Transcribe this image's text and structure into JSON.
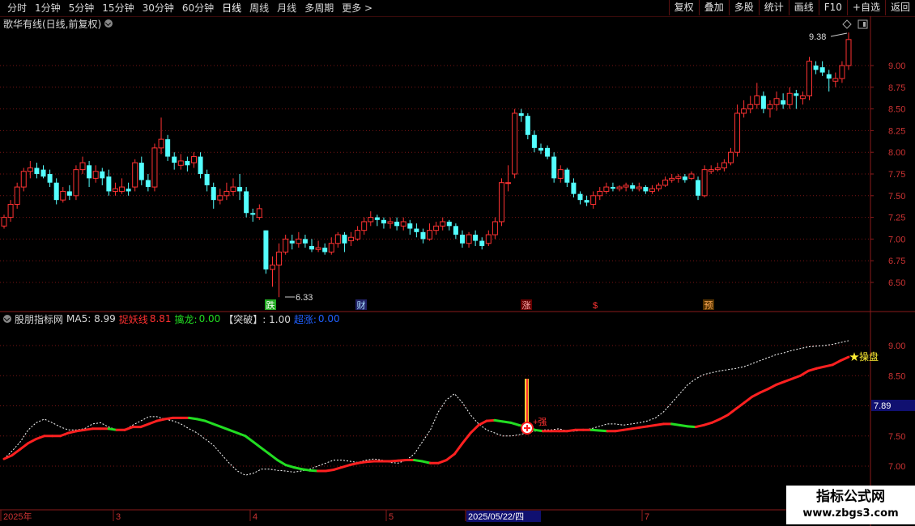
{
  "toolbar": {
    "periods": [
      "分时",
      "1分钟",
      "5分钟",
      "15分钟",
      "30分钟",
      "60分钟",
      "日线",
      "周线",
      "月线",
      "多周期",
      "更多 >"
    ],
    "active_period": "日线",
    "right_buttons": [
      "复权",
      "叠加",
      "多股",
      "统计",
      "画线",
      "F10",
      "+自选",
      "返回"
    ]
  },
  "main_chart": {
    "title": "歌华有线(日线,前复权)",
    "high_label": "9.38",
    "low_label": "6.33",
    "price_ticks": [
      "9.00",
      "8.75",
      "8.50",
      "8.25",
      "8.00",
      "7.75",
      "7.50",
      "7.25",
      "7.00",
      "6.75",
      "6.50"
    ],
    "markers": [
      "跌",
      "财",
      "涨",
      "$",
      "预"
    ]
  },
  "indicator": {
    "name": "股朋指标网",
    "ma5_label": "MA5: 8.99",
    "yaoxian_label": "捉妖线",
    "yaoxian_value": "8.81",
    "qinlong_label": "擒龙:",
    "qinlong_value": "0.00",
    "tupo_label": "【突破】: 1.00",
    "chaozhang_label": "超涨:",
    "chaozhang_value": "0.00",
    "ticks": [
      "9.00",
      "8.50",
      "8.00",
      "7.50",
      "7.00"
    ],
    "current_value_badge": "7.89",
    "star_label": "★操盘",
    "signal_label": "+强"
  },
  "date_axis": {
    "labels": [
      "2025年",
      "3",
      "4",
      "5",
      "2025/05/22/四",
      "7"
    ]
  },
  "watermark": {
    "line1": "指标公式网",
    "line2": "www.zbgs3.com"
  },
  "colors": {
    "up": "#ff3232",
    "down": "#54ffff",
    "grid": "#7a1515",
    "ma_red": "#ff2020",
    "ma_green": "#22dd22"
  },
  "chart_data": {
    "type": "candlestick",
    "ylim": [
      6.3,
      9.5
    ],
    "candles": [
      [
        7.15,
        7.25,
        7.28,
        7.12
      ],
      [
        7.25,
        7.4,
        7.45,
        7.2
      ],
      [
        7.4,
        7.6,
        7.65,
        7.35
      ],
      [
        7.6,
        7.78,
        7.82,
        7.55
      ],
      [
        7.78,
        7.82,
        7.9,
        7.7
      ],
      [
        7.82,
        7.75,
        7.88,
        7.7
      ],
      [
        7.8,
        7.72,
        7.85,
        7.7
      ],
      [
        7.75,
        7.65,
        7.8,
        7.6
      ],
      [
        7.65,
        7.45,
        7.7,
        7.4
      ],
      [
        7.45,
        7.55,
        7.6,
        7.42
      ],
      [
        7.55,
        7.5,
        7.62,
        7.45
      ],
      [
        7.5,
        7.8,
        7.85,
        7.45
      ],
      [
        7.8,
        7.88,
        7.95,
        7.75
      ],
      [
        7.85,
        7.7,
        7.9,
        7.6
      ],
      [
        7.7,
        7.78,
        7.85,
        7.65
      ],
      [
        7.78,
        7.7,
        7.82,
        7.62
      ],
      [
        7.72,
        7.55,
        7.8,
        7.5
      ],
      [
        7.55,
        7.58,
        7.65,
        7.5
      ],
      [
        7.55,
        7.6,
        7.7,
        7.52
      ],
      [
        7.58,
        7.55,
        7.65,
        7.5
      ],
      [
        7.6,
        7.88,
        7.92,
        7.55
      ],
      [
        7.88,
        7.68,
        7.95,
        7.62
      ],
      [
        7.68,
        7.6,
        7.75,
        7.55
      ],
      [
        7.6,
        8.05,
        8.1,
        7.55
      ],
      [
        8.05,
        8.15,
        8.4,
        7.98
      ],
      [
        8.15,
        7.95,
        8.2,
        7.9
      ],
      [
        7.95,
        7.88,
        8.0,
        7.8
      ],
      [
        7.85,
        7.9,
        7.98,
        7.8
      ],
      [
        7.9,
        7.85,
        7.95,
        7.78
      ],
      [
        7.88,
        7.95,
        8.0,
        7.82
      ],
      [
        7.95,
        7.75,
        8.0,
        7.7
      ],
      [
        7.75,
        7.62,
        7.8,
        7.55
      ],
      [
        7.6,
        7.45,
        7.65,
        7.35
      ],
      [
        7.45,
        7.5,
        7.58,
        7.4
      ],
      [
        7.5,
        7.55,
        7.65,
        7.45
      ],
      [
        7.55,
        7.6,
        7.7,
        7.5
      ],
      [
        7.6,
        7.55,
        7.75,
        7.45
      ],
      [
        7.55,
        7.3,
        7.6,
        7.25
      ],
      [
        7.3,
        7.28,
        7.35,
        7.2
      ],
      [
        7.25,
        7.35,
        7.4,
        7.22
      ],
      [
        7.1,
        6.65,
        7.1,
        6.6
      ],
      [
        6.65,
        6.7,
        6.8,
        6.45
      ],
      [
        6.7,
        6.85,
        6.95,
        6.33
      ],
      [
        6.85,
        7.0,
        7.05,
        6.82
      ],
      [
        6.98,
        6.95,
        7.05,
        6.88
      ],
      [
        6.95,
        7.0,
        7.08,
        6.9
      ],
      [
        7.0,
        6.95,
        7.05,
        6.9
      ],
      [
        6.92,
        6.88,
        7.0,
        6.85
      ],
      [
        6.88,
        6.9,
        6.98,
        6.85
      ],
      [
        6.9,
        6.85,
        6.95,
        6.82
      ],
      [
        6.85,
        6.95,
        7.02,
        6.82
      ],
      [
        6.95,
        7.05,
        7.08,
        6.9
      ],
      [
        7.05,
        6.95,
        7.08,
        6.85
      ],
      [
        6.98,
        7.02,
        7.08,
        6.92
      ],
      [
        7.0,
        7.1,
        7.15,
        6.98
      ],
      [
        7.1,
        7.2,
        7.25,
        7.05
      ],
      [
        7.2,
        7.25,
        7.32,
        7.15
      ],
      [
        7.25,
        7.22,
        7.28,
        7.15
      ],
      [
        7.22,
        7.18,
        7.25,
        7.12
      ],
      [
        7.18,
        7.2,
        7.25,
        7.12
      ],
      [
        7.2,
        7.15,
        7.25,
        7.1
      ],
      [
        7.15,
        7.2,
        7.25,
        7.1
      ],
      [
        7.18,
        7.12,
        7.22,
        7.05
      ],
      [
        7.12,
        7.08,
        7.18,
        7.02
      ],
      [
        7.08,
        7.0,
        7.12,
        6.95
      ],
      [
        7.0,
        7.1,
        7.18,
        6.98
      ],
      [
        7.1,
        7.15,
        7.2,
        7.05
      ],
      [
        7.15,
        7.2,
        7.25,
        7.1
      ],
      [
        7.2,
        7.15,
        7.22,
        7.1
      ],
      [
        7.15,
        7.05,
        7.18,
        7.0
      ],
      [
        7.05,
        6.95,
        7.1,
        6.9
      ],
      [
        6.95,
        7.05,
        7.08,
        6.9
      ],
      [
        7.05,
        6.98,
        7.1,
        6.92
      ],
      [
        6.98,
        6.92,
        7.02,
        6.88
      ],
      [
        6.95,
        7.05,
        7.1,
        6.92
      ],
      [
        7.05,
        7.2,
        7.25,
        7.0
      ],
      [
        7.2,
        7.65,
        7.7,
        7.15
      ],
      [
        7.65,
        7.65,
        7.85,
        7.55
      ],
      [
        7.75,
        8.45,
        8.5,
        7.7
      ],
      [
        8.45,
        8.42,
        8.5,
        8.35
      ],
      [
        8.42,
        8.2,
        8.45,
        8.15
      ],
      [
        8.2,
        8.05,
        8.25,
        8.0
      ],
      [
        8.05,
        8.02,
        8.1,
        7.98
      ],
      [
        8.05,
        7.95,
        8.08,
        7.92
      ],
      [
        7.95,
        7.7,
        8.0,
        7.65
      ],
      [
        7.7,
        7.8,
        7.85,
        7.65
      ],
      [
        7.8,
        7.65,
        7.82,
        7.6
      ],
      [
        7.65,
        7.52,
        7.7,
        7.48
      ],
      [
        7.52,
        7.45,
        7.55,
        7.4
      ],
      [
        7.45,
        7.42,
        7.5,
        7.38
      ],
      [
        7.4,
        7.5,
        7.55,
        7.35
      ],
      [
        7.5,
        7.55,
        7.6,
        7.45
      ],
      [
        7.55,
        7.6,
        7.65,
        7.52
      ],
      [
        7.6,
        7.58,
        7.65,
        7.55
      ],
      [
        7.58,
        7.6,
        7.62,
        7.55
      ],
      [
        7.6,
        7.62,
        7.65,
        7.55
      ],
      [
        7.62,
        7.58,
        7.65,
        7.55
      ],
      [
        7.58,
        7.6,
        7.65,
        7.55
      ],
      [
        7.6,
        7.55,
        7.62,
        7.52
      ],
      [
        7.55,
        7.58,
        7.62,
        7.52
      ],
      [
        7.58,
        7.62,
        7.65,
        7.55
      ],
      [
        7.62,
        7.68,
        7.72,
        7.6
      ],
      [
        7.68,
        7.7,
        7.75,
        7.65
      ],
      [
        7.7,
        7.72,
        7.75,
        7.65
      ],
      [
        7.72,
        7.68,
        7.75,
        7.65
      ],
      [
        7.7,
        7.75,
        7.78,
        7.68
      ],
      [
        7.68,
        7.5,
        7.72,
        7.45
      ],
      [
        7.5,
        7.8,
        7.85,
        7.48
      ],
      [
        7.78,
        7.8,
        7.85,
        7.75
      ],
      [
        7.8,
        7.82,
        7.88,
        7.78
      ],
      [
        7.82,
        7.88,
        7.92,
        7.78
      ],
      [
        7.88,
        8.0,
        8.05,
        7.85
      ],
      [
        8.0,
        8.45,
        8.55,
        7.95
      ],
      [
        8.45,
        8.5,
        8.6,
        8.4
      ],
      [
        8.5,
        8.55,
        8.65,
        8.45
      ],
      [
        8.55,
        8.65,
        8.8,
        8.5
      ],
      [
        8.65,
        8.5,
        8.7,
        8.45
      ],
      [
        8.5,
        8.55,
        8.6,
        8.4
      ],
      [
        8.55,
        8.62,
        8.7,
        8.48
      ],
      [
        8.6,
        8.55,
        8.68,
        8.5
      ],
      [
        8.55,
        8.68,
        8.75,
        8.5
      ],
      [
        8.68,
        8.65,
        8.72,
        8.5
      ],
      [
        8.62,
        8.65,
        8.7,
        8.55
      ],
      [
        8.65,
        9.05,
        9.1,
        8.6
      ],
      [
        9.0,
        8.95,
        9.05,
        8.9
      ],
      [
        8.98,
        8.92,
        9.05,
        8.88
      ],
      [
        8.9,
        8.85,
        8.95,
        8.7
      ],
      [
        8.82,
        8.85,
        8.92,
        8.75
      ],
      [
        8.85,
        9.0,
        9.05,
        8.8
      ],
      [
        9.0,
        9.3,
        9.38,
        8.95
      ]
    ],
    "indicator_yaoxian": [
      7.12,
      7.18,
      7.28,
      7.38,
      7.45,
      7.5,
      7.5,
      7.5,
      7.55,
      7.58,
      7.6,
      7.62,
      7.62,
      7.62,
      7.6,
      7.6,
      7.65,
      7.65,
      7.7,
      7.75,
      7.78,
      7.8,
      7.8,
      7.8,
      7.78,
      7.75,
      7.7,
      7.65,
      7.6,
      7.55,
      7.5,
      7.4,
      7.3,
      7.2,
      7.1,
      7.02,
      6.98,
      6.95,
      6.93,
      6.92,
      6.92,
      6.94,
      6.98,
      7.02,
      7.05,
      7.07,
      7.08,
      7.08,
      7.08,
      7.09,
      7.1,
      7.1,
      7.08,
      7.05,
      7.05,
      7.1,
      7.2,
      7.38,
      7.55,
      7.68,
      7.75,
      7.76,
      7.74,
      7.72,
      7.68,
      7.65,
      7.6,
      7.58,
      7.58,
      7.58,
      7.58,
      7.6,
      7.6,
      7.6,
      7.59,
      7.58,
      7.58,
      7.6,
      7.62,
      7.64,
      7.66,
      7.68,
      7.7,
      7.7,
      7.68,
      7.66,
      7.65,
      7.68,
      7.72,
      7.78,
      7.85,
      7.95,
      8.05,
      8.15,
      8.22,
      8.28,
      8.35,
      8.4,
      8.45,
      8.5,
      8.58,
      8.62,
      8.65,
      8.68,
      8.75,
      8.81
    ],
    "indicator_ma": [
      7.12,
      7.25,
      7.4,
      7.6,
      7.72,
      7.78,
      7.72,
      7.65,
      7.6,
      7.6,
      7.62,
      7.7,
      7.72,
      7.65,
      7.6,
      7.6,
      7.68,
      7.75,
      7.82,
      7.82,
      7.78,
      7.75,
      7.7,
      7.62,
      7.55,
      7.45,
      7.35,
      7.2,
      7.05,
      6.92,
      6.85,
      6.88,
      6.95,
      6.95,
      6.93,
      6.92,
      6.9,
      6.92,
      6.95,
      7.0,
      7.05,
      7.1,
      7.1,
      7.08,
      7.06,
      7.1,
      7.12,
      7.1,
      7.06,
      7.05,
      7.1,
      7.2,
      7.4,
      7.6,
      7.9,
      8.1,
      8.2,
      8.05,
      7.85,
      7.7,
      7.6,
      7.55,
      7.5,
      7.5,
      7.52,
      7.55,
      7.58,
      7.6,
      7.6,
      7.62,
      7.58,
      7.58,
      7.6,
      7.62,
      7.66,
      7.7,
      7.7,
      7.68,
      7.7,
      7.72,
      7.75,
      7.8,
      7.9,
      8.05,
      8.2,
      8.35,
      8.45,
      8.52,
      8.55,
      8.58,
      8.6,
      8.62,
      8.65,
      8.7,
      8.75,
      8.8,
      8.85,
      8.88,
      8.92,
      8.95,
      8.98,
      8.99,
      9.0,
      9.02,
      9.05,
      9.08
    ]
  }
}
